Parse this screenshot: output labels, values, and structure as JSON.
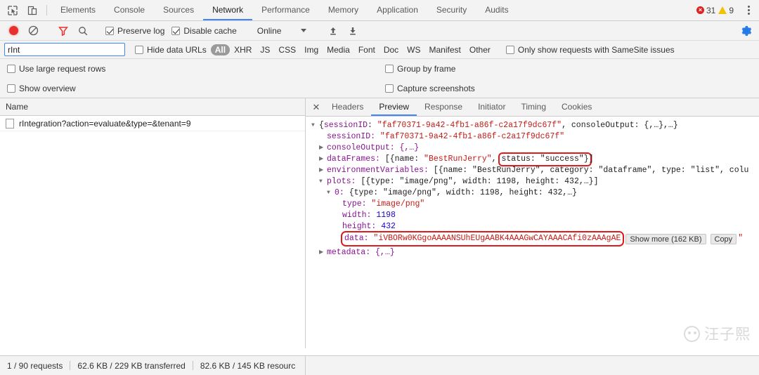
{
  "devtools": {
    "main_tabs": [
      {
        "label": "Elements",
        "active": false
      },
      {
        "label": "Console",
        "active": false
      },
      {
        "label": "Sources",
        "active": false
      },
      {
        "label": "Network",
        "active": true
      },
      {
        "label": "Performance",
        "active": false
      },
      {
        "label": "Memory",
        "active": false
      },
      {
        "label": "Application",
        "active": false
      },
      {
        "label": "Security",
        "active": false
      },
      {
        "label": "Audits",
        "active": false
      }
    ],
    "error_count": "31",
    "warning_count": "9",
    "error_glyph": "×",
    "icons": {
      "inspect": "inspect-element-icon",
      "device": "device-toolbar-icon",
      "more": "more-options-icon",
      "settings": "settings-gear-icon"
    }
  },
  "toolbar": {
    "record_tooltip": "Record",
    "clear_glyph": "⊘",
    "filter_glyph": "filter-funnel",
    "search_glyph": "⌕",
    "preserve_log": {
      "label": "Preserve log",
      "checked": true
    },
    "disable_cache": {
      "label": "Disable cache",
      "checked": true
    },
    "throttle_value": "Online",
    "import_glyph": "⬆",
    "export_glyph": "⬇"
  },
  "filterbar": {
    "filter_value": "rInt",
    "filter_placeholder": "Filter",
    "hide_data_urls": {
      "label": "Hide data URLs",
      "checked": false
    },
    "types": [
      {
        "label": "All",
        "selected": true
      },
      {
        "label": "XHR",
        "selected": false
      },
      {
        "label": "JS",
        "selected": false
      },
      {
        "label": "CSS",
        "selected": false
      },
      {
        "label": "Img",
        "selected": false
      },
      {
        "label": "Media",
        "selected": false
      },
      {
        "label": "Font",
        "selected": false
      },
      {
        "label": "Doc",
        "selected": false
      },
      {
        "label": "WS",
        "selected": false
      },
      {
        "label": "Manifest",
        "selected": false
      },
      {
        "label": "Other",
        "selected": false
      }
    ],
    "samesite": {
      "label": "Only show requests with SameSite issues",
      "checked": false
    }
  },
  "options": {
    "use_large_rows": {
      "label": "Use large request rows",
      "checked": false
    },
    "group_by_frame": {
      "label": "Group by frame",
      "checked": false
    },
    "show_overview": {
      "label": "Show overview",
      "checked": false
    },
    "capture_screenshots": {
      "label": "Capture screenshots",
      "checked": false
    }
  },
  "requests": {
    "column_header": "Name",
    "rows": [
      {
        "name": "rIntegration?action=evaluate&type=&tenant=9"
      }
    ]
  },
  "detail": {
    "close_glyph": "✕",
    "tabs": [
      {
        "label": "Headers",
        "active": false
      },
      {
        "label": "Preview",
        "active": true
      },
      {
        "label": "Response",
        "active": false
      },
      {
        "label": "Initiator",
        "active": false
      },
      {
        "label": "Timing",
        "active": false
      },
      {
        "label": "Cookies",
        "active": false
      }
    ]
  },
  "preview": {
    "root_prefix": "{",
    "root": {
      "key": "sessionID",
      "value": "\"faf70371-9a42-4fb1-a86f-c2a17f9dc67f\"",
      "rest": ", consoleOutput: {,…},…}"
    },
    "lines": {
      "session_key": "sessionID: ",
      "session_value": "\"faf70371-9a42-4fb1-a86f-c2a17f9dc67f\"",
      "console_output": "consoleOutput: {,…}",
      "dataframes_key": "dataFrames: ",
      "dataframes_pre": "[{name: ",
      "dataframes_name": "\"BestRunJerry\"",
      "dataframes_comma": ", ",
      "dataframes_status": "status: \"success\"}",
      "dataframes_tail": "]",
      "envvars_key": "environmentVariables: ",
      "envvars_value": "[{name: \"BestRunJerry\", category: \"dataframe\", type: \"list\", colu",
      "plots_key": "plots: ",
      "plots_value": "[{type: \"image/png\", width: 1198, height: 432,…}]",
      "plot0_key": "0: ",
      "plot0_value": "{type: \"image/png\", width: 1198, height: 432,…}",
      "type_key": "type: ",
      "type_value": "\"image/png\"",
      "width_key": "width: ",
      "width_value": "1198",
      "height_key": "height: ",
      "height_value": "432",
      "data_key": "data: ",
      "data_value": "\"iVBORw0KGgoAAAANSUhEUgAABK4AAAGwCAYAAACAfi0zAAAgAE",
      "show_more": "Show more (162 KB)",
      "copy": "Copy",
      "data_quote": "\"",
      "metadata": "metadata: {,…}"
    },
    "highlights": [
      "status-success",
      "data-base64"
    ]
  },
  "status": {
    "requests": "1 / 90 requests",
    "transferred": "62.6 KB / 229 KB transferred",
    "resources": "82.6 KB / 145 KB resourc"
  },
  "watermark": {
    "text": "汪子熙"
  },
  "colors": {
    "accent": "#4285f4",
    "record_active": "#e8312f",
    "filter_active": "#e8312f",
    "highlight_box": "#e01b1b",
    "gear": "#1a73e8",
    "toolbar_bg": "#f3f3f3",
    "json_key": "#881391",
    "json_string": "#c41a16",
    "json_number": "#1c00cf"
  }
}
